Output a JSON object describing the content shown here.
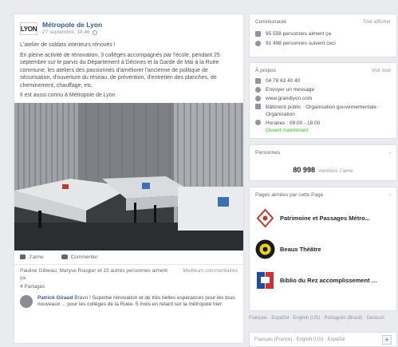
{
  "post": {
    "page_name": "Métropole de Lyon",
    "logo_text": "LYON",
    "date": "27 septembre, 18:46",
    "paragraphs": [
      "L'atelier de soldats intérieurs rénovés !",
      "En pleine activité de rénovation, 3 collèges accompagnés par l'école, pendant 25 septembre sur le parvis du Département à Décines et la Garde de Mai à la Ruée commune, les ateliers des passionnés d'améliorer l'ancienne de politique de sécurisation, d'ouverture du réseau, de prévention, d'entretien des planches, de cheminement, chauffage, etc.",
      "Il est aussi connu à Métropole de Lyon"
    ],
    "link_text": "Lyon",
    "actions": {
      "like": "J'aime",
      "comment": "Commenter"
    },
    "likes_text": "Pauline Gilbeau, Maryse Rougier et 15 autres personnes aiment ça.",
    "likes_right": "Meilleurs commentaires",
    "shares": "4 Partages",
    "comment": {
      "author": "Patrick Giraud",
      "text": "Bravo ! Superbe rénovation et de très belles espérances pour les tous nouveaux ... pour les collèges de la Ruée. 5 mois en retard sur la métropole hier."
    }
  },
  "about": {
    "title": "Communauté",
    "link": "Tout afficher",
    "rows": [
      {
        "icon": "people-icon",
        "text": "95 558 personnes aiment ça"
      },
      {
        "icon": "follow-icon",
        "text": "91 498 personnes suivent ceci"
      }
    ]
  },
  "info": {
    "title": "À propos",
    "link": "Voir tout",
    "rows": [
      {
        "icon": "phone-icon",
        "text": "04 78 63 40 40"
      },
      {
        "icon": "messenger-icon",
        "text": "Envoyer un message"
      },
      {
        "icon": "globe-icon",
        "text": "www.grandlyon.com"
      },
      {
        "icon": "category-icon",
        "text": "Bâtiment public · Organisation gouvernementale · Organisation"
      },
      {
        "icon": "clock-icon",
        "text": "Horaires : 09:00 - 18:00"
      }
    ],
    "open_status": "Ouvert maintenant"
  },
  "stats": {
    "title": "Personnes",
    "number": "80 998",
    "number_suffix": "mentions J'aime"
  },
  "related": {
    "title": "Pages aimées par cette Page",
    "items": [
      {
        "name": "Patrimoine et Passages Métro..."
      },
      {
        "name": "Beaux Théâtre"
      },
      {
        "name": "Biblio du Rez accomplissement de..."
      }
    ]
  },
  "footer": {
    "links": "Français · Español · English (US) · Português (Brasil) · Deutsch",
    "lang": "Français (France) · English (US) · Español",
    "plus": "+"
  },
  "colors": {
    "link": "#385898",
    "background": "#e9ebee",
    "card": "#ffffff",
    "open": "#42b72a"
  }
}
